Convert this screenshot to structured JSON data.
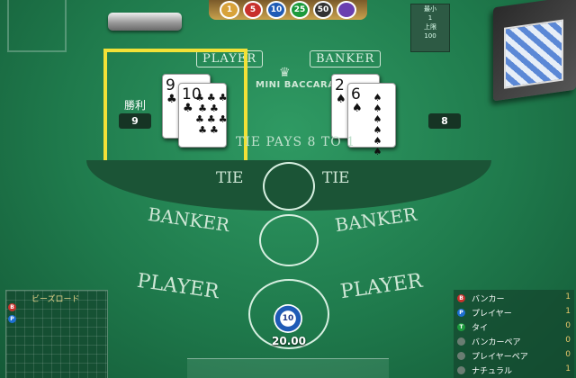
{
  "top": {
    "chip_tray": [
      "1",
      "5",
      "10",
      "25",
      "50",
      ""
    ],
    "limits": {
      "min_label": "最小",
      "min_value": "1",
      "max_label": "上限",
      "max_value": "100"
    }
  },
  "table": {
    "player_tab": "PLAYER",
    "banker_tab": "BANKER",
    "game_title": "MINI BACCARAT",
    "tie_pays": "TIE PAYS 8 TO 1",
    "tie_label": "TIE",
    "banker_label": "BANKER",
    "player_label": "PLAYER"
  },
  "player_hand": {
    "winner_label": "勝利",
    "score": "9",
    "cards": [
      {
        "rank": "9",
        "suit": "♣"
      },
      {
        "rank": "10",
        "suit": "♣"
      }
    ]
  },
  "banker_hand": {
    "score": "8",
    "cards": [
      {
        "rank": "2",
        "suit": "♠"
      },
      {
        "rank": "6",
        "suit": "♠"
      }
    ]
  },
  "bet": {
    "chip_value": "10",
    "amount": "20.00"
  },
  "road": {
    "title": "ビーズロード",
    "beads": [
      "B",
      "P"
    ]
  },
  "stats": {
    "items": [
      {
        "icon": "B",
        "label": "バンカー",
        "value": "1"
      },
      {
        "icon": "P",
        "label": "プレイヤー",
        "value": "1"
      },
      {
        "icon": "T",
        "label": "タイ",
        "value": "0"
      },
      {
        "icon": "",
        "label": "バンカーペア",
        "value": "0"
      },
      {
        "icon": "",
        "label": "プレイヤーペア",
        "value": "0"
      },
      {
        "icon": "",
        "label": "ナチュラル",
        "value": "1"
      }
    ]
  },
  "colors": {
    "felt": "#1f7a4c",
    "highlight": "#f2e137",
    "banker_red": "#c8312c",
    "player_blue": "#1d6fd1",
    "tie_green": "#1c9a3c"
  }
}
